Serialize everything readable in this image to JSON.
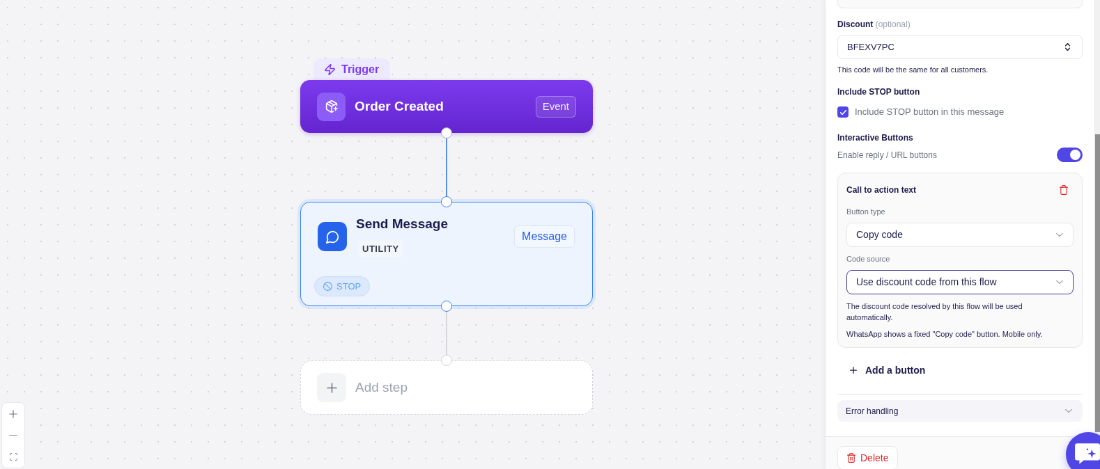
{
  "canvas": {
    "nodes": [
      {
        "kind": "trigger",
        "tab": "Trigger",
        "title": "Order Created",
        "badge": "Event",
        "selected": false
      },
      {
        "kind": "action",
        "title": "Send Message",
        "tag": "UTILITY",
        "badge": "Message",
        "stop_label": "STOP",
        "selected": true
      },
      {
        "kind": "add",
        "title": "Add step",
        "selected": false
      }
    ]
  },
  "panel": {
    "discount": {
      "label": "Discount",
      "hint": "(optional)",
      "value": "BFEXV7PC",
      "help": "This code will be the same for all customers."
    },
    "stop_button": {
      "title": "Include STOP button",
      "label": "Include STOP button in this message",
      "checked": true
    },
    "interactive_buttons": {
      "title": "Interactive Buttons",
      "toggle_label": "Enable reply / URL buttons",
      "on": true,
      "buttons": [
        {
          "title": "Call to action text",
          "fields": [
            {
              "label": "Button type",
              "value": "Copy code",
              "focused": false
            },
            {
              "label": "Code source",
              "value": "Use discount code from this flow",
              "focused": true
            }
          ],
          "notes": [
            "The discount code resolved by this flow will be used automatically.",
            "WhatsApp shows a fixed \"Copy code\" button. Mobile only."
          ]
        }
      ],
      "add_label": "Add a button"
    },
    "sections": [
      {
        "title": "Error handling",
        "expanded": false
      }
    ],
    "delete_label": "Delete"
  }
}
